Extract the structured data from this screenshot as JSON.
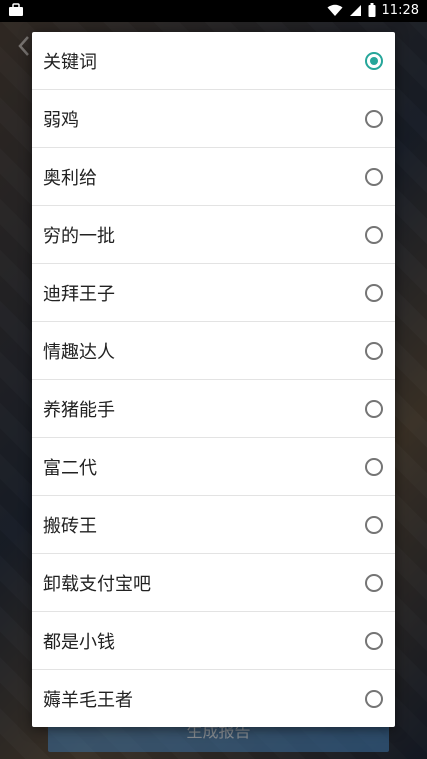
{
  "status_bar": {
    "time": "11:28",
    "icons": [
      "briefcase-icon",
      "wifi-icon",
      "signal-icon",
      "battery-icon"
    ]
  },
  "background": {
    "generate_button_label": "生成报告"
  },
  "dialog": {
    "accent_color": "#26a69a",
    "options": [
      {
        "label": "关键词",
        "checked": true
      },
      {
        "label": "弱鸡",
        "checked": false
      },
      {
        "label": "奥利给",
        "checked": false
      },
      {
        "label": "穷的一批",
        "checked": false
      },
      {
        "label": "迪拜王子",
        "checked": false
      },
      {
        "label": "情趣达人",
        "checked": false
      },
      {
        "label": "养猪能手",
        "checked": false
      },
      {
        "label": "富二代",
        "checked": false
      },
      {
        "label": "搬砖王",
        "checked": false
      },
      {
        "label": "卸载支付宝吧",
        "checked": false
      },
      {
        "label": "都是小钱",
        "checked": false
      },
      {
        "label": "薅羊毛王者",
        "checked": false
      }
    ]
  }
}
